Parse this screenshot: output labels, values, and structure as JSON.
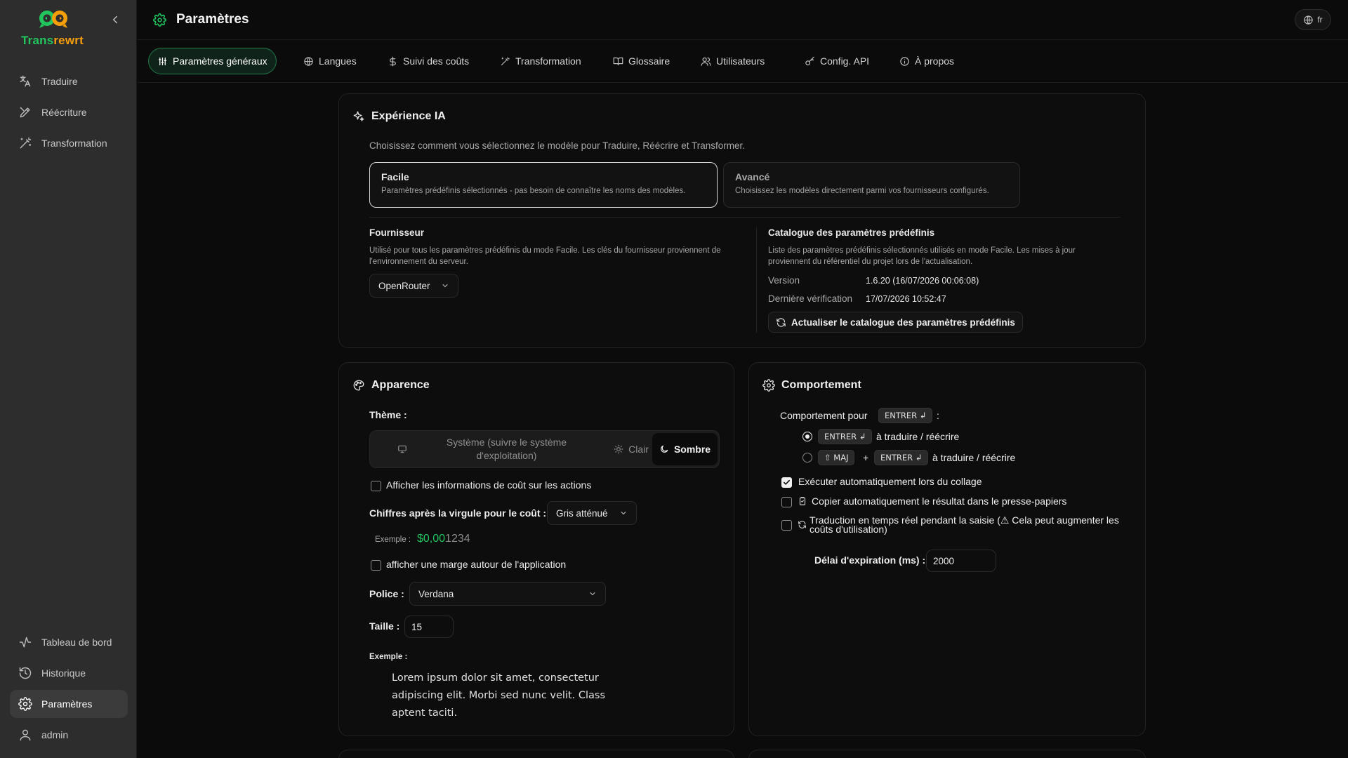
{
  "app": {
    "name_part1": "Trans",
    "name_part2": "rewrt"
  },
  "colors": {
    "accent": "#22c55e",
    "brand_orange": "#f59e0b",
    "background": "#0b0b0b",
    "sidebar": "#2d2d2d"
  },
  "sidebar": {
    "top_items": [
      {
        "label": "Traduire",
        "icon": "translate-icon"
      },
      {
        "label": "Réécriture",
        "icon": "rewrite-icon"
      },
      {
        "label": "Transformation",
        "icon": "wand-icon"
      }
    ],
    "bottom_items": [
      {
        "label": "Tableau de bord",
        "icon": "activity-icon"
      },
      {
        "label": "Historique",
        "icon": "history-icon"
      },
      {
        "label": "Paramètres",
        "icon": "gear-icon",
        "active": true
      },
      {
        "label": "admin",
        "icon": "user-icon"
      }
    ]
  },
  "header": {
    "title": "Paramètres",
    "language": "fr"
  },
  "tabs": [
    {
      "label": "Paramètres généraux",
      "icon": "sliders-icon",
      "active": true
    },
    {
      "label": "Langues",
      "icon": "globe-icon"
    },
    {
      "label": "Suivi des coûts",
      "icon": "dollar-icon"
    },
    {
      "label": "Transformation",
      "icon": "wand-icon"
    },
    {
      "label": "Glossaire",
      "icon": "book-icon"
    },
    {
      "label": "Utilisateurs",
      "icon": "users-icon"
    },
    {
      "label": "Config. API",
      "icon": "key-icon"
    },
    {
      "label": "À propos",
      "icon": "info-icon"
    }
  ],
  "ai": {
    "title": "Expérience IA",
    "description": "Choisissez comment vous sélectionnez le modèle pour Traduire, Réécrire et Transformer.",
    "modes": [
      {
        "title": "Facile",
        "description": "Paramètres prédéfinis sélectionnés - pas besoin de connaître les noms des modèles.",
        "selected": true
      },
      {
        "title": "Avancé",
        "description": "Choisissez les modèles directement parmi vos fournisseurs configurés.",
        "selected": false
      }
    ],
    "provider": {
      "label": "Fournisseur",
      "description": "Utilisé pour tous les paramètres prédéfinis du mode Facile. Les clés du fournisseur proviennent de l'environnement du serveur.",
      "value": "OpenRouter"
    },
    "catalog": {
      "label": "Catalogue des paramètres prédéfinis",
      "description": "Liste des paramètres prédéfinis sélectionnés utilisés en mode Facile. Les mises à jour proviennent du référentiel du projet lors de l'actualisation.",
      "version_label": "Version",
      "version_value": "1.6.20 (16/07/2026 00:06:08)",
      "checked_label": "Dernière vérification",
      "checked_value": "17/07/2026 10:52:47",
      "refresh_button": "Actualiser le catalogue des paramètres prédéfinis"
    }
  },
  "appearance": {
    "title": "Apparence",
    "theme_label": "Thème :",
    "theme_options": [
      {
        "label": "Système (suivre le système d'exploitation)",
        "icon": "monitor-icon"
      },
      {
        "label": "Clair",
        "icon": "sun-icon"
      },
      {
        "label": "Sombre",
        "icon": "moon-icon",
        "active": true
      }
    ],
    "show_cost_label": "Afficher les informations de coût sur les actions",
    "show_cost_checked": false,
    "decimals_label": "Chiffres après la virgule pour le coût :",
    "decimals_value": "Gris atténué",
    "example_label": "Exemple :",
    "example_value_main": "$0,00",
    "example_value_dim": "1234",
    "margin_label": "afficher une marge autour de l'application",
    "margin_checked": false,
    "font_label": "Police :",
    "font_value": "Verdana",
    "size_label": "Taille :",
    "size_value": "15",
    "preview_label": "Exemple :",
    "preview_text": "Lorem ipsum dolor sit amet, consectetur adipiscing elit. Morbi sed nunc velit. Class aptent taciti."
  },
  "behavior": {
    "title": "Comportement",
    "enter_label": "Comportement pour",
    "enter_key": "ENTRER ↲",
    "colon": ":",
    "options": [
      {
        "keys": [
          "ENTRER ↲"
        ],
        "text": "à traduire / réécrire",
        "selected": true
      },
      {
        "keys": [
          "⇧ MAJ",
          "ENTRER ↲"
        ],
        "plus": "+",
        "text": "à traduire / réécrire",
        "selected": false
      }
    ],
    "auto_paste_label": "Exécuter automatiquement lors du collage",
    "auto_paste_checked": true,
    "auto_copy_label": "Copier automatiquement le résultat dans le presse-papiers",
    "auto_copy_checked": false,
    "realtime_label": "Traduction en temps réel pendant la saisie (⚠ Cela peut augmenter les coûts d'utilisation)",
    "realtime_checked": false,
    "timeout_label": "Délai d'expiration (ms) :",
    "timeout_value": "2000"
  }
}
